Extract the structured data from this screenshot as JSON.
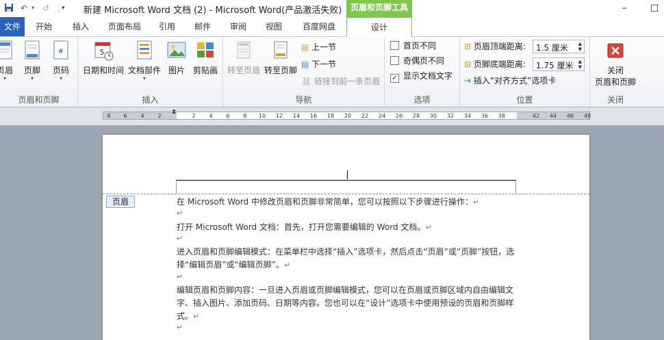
{
  "titlebar": {
    "title": "新建 Microsoft Word 文档 (2) - Microsoft Word(产品激活失败)",
    "context_tool": "页眉和页脚工具",
    "minimize": "–",
    "maximize": "□"
  },
  "tabs": {
    "file": "文件",
    "home": "开始",
    "insert": "插入",
    "layout": "页面布局",
    "references": "引用",
    "mailings": "邮件",
    "review": "审阅",
    "view": "视图",
    "baidu": "百度网盘",
    "design": "设计"
  },
  "ribbon": {
    "groups": {
      "header_footer": {
        "label": "页眉和页脚",
        "header": "页眉",
        "footer": "页脚",
        "page_number": "页码"
      },
      "insert": {
        "label": "插入",
        "datetime": "日期和时间",
        "quickparts": "文档部件",
        "picture": "图片",
        "clipart": "剪贴画"
      },
      "navigation": {
        "label": "导航",
        "goto_header": "转至页眉",
        "goto_footer": "转至页脚",
        "previous": "上一节",
        "next": "下一节",
        "link_previous": "链接到前一条页眉"
      },
      "options": {
        "label": "选项",
        "different_first": "首页不同",
        "different_odd_even": "奇偶页不同",
        "show_text": "显示文档文字"
      },
      "position": {
        "label": "位置",
        "header_from_top": "页眉顶端距离:",
        "header_value": "1.5 厘米",
        "footer_from_bottom": "页脚底端距离:",
        "footer_value": "1.75 厘米",
        "insert_align_tab": "插入“对齐方式”选项卡"
      },
      "close": {
        "label": "关闭",
        "close_line1": "关闭",
        "close_line2": "页眉和页脚"
      }
    }
  },
  "ruler": {
    "labels": [
      "8",
      "6",
      "4",
      "2",
      "2",
      "4",
      "6",
      "8",
      "10",
      "12",
      "14",
      "16",
      "18",
      "20",
      "22",
      "24",
      "26",
      "28",
      "30",
      "32",
      "34",
      "36",
      "38",
      "42",
      "44",
      "46",
      "48"
    ]
  },
  "document": {
    "header_tag": "页眉",
    "paragraphs": [
      "在 Microsoft Word 中修改页眉和页脚非常简单，您可以按照以下步骤进行操作：",
      "打开 Microsoft Word 文档：首先，打开您需要编辑的 Word 文档。",
      "进入页眉和页脚编辑模式：在菜单栏中选择“插入”选项卡，然后点击“页眉”或“页脚”按钮，选择“编辑页眉”或“编辑页脚”。",
      "编辑页眉和页脚内容：一旦进入页眉或页脚编辑模式，您可以在页眉或页脚区域内自由编辑文字、插入图片、添加页码、日期等内容。您也可以在“设计”选项卡中使用预设的页眉和页脚样式。"
    ],
    "para_mark": "↵"
  }
}
